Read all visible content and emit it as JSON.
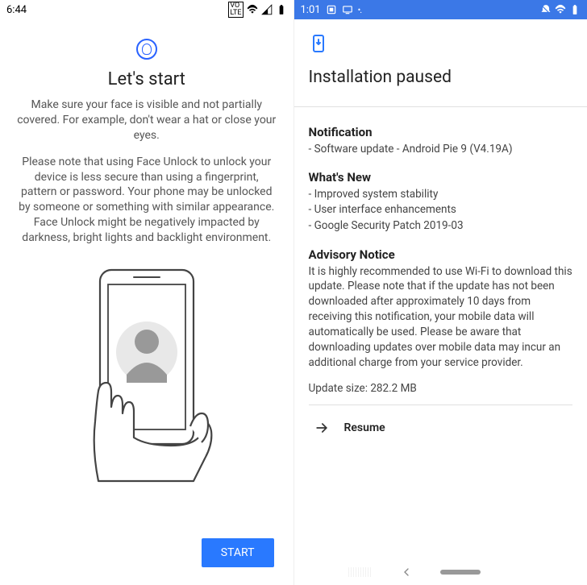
{
  "left": {
    "time": "6:44",
    "title": "Let's start",
    "paragraph1": "Make sure your face is visible and not partially covered. For example, don't wear a hat or close your eyes.",
    "paragraph2": "Please note that using Face Unlock to unlock your device is less secure than using a fingerprint, pattern or password. Your phone may be unlocked by someone or something with similar appearance. Face Unlock might be negatively impacted by darkness, bright lights and backlight environment.",
    "start_button": "START"
  },
  "right": {
    "time": "1:01",
    "title": "Installation paused",
    "notification_heading": "Notification",
    "notification_text": "- Software update - Android Pie 9 (V4.19A)",
    "whats_new_heading": "What's New",
    "whats_new_items": [
      "- Improved system stability",
      "- User interface enhancements",
      "- Google Security Patch 2019-03"
    ],
    "advisory_heading": "Advisory Notice",
    "advisory_text": "It is highly recommended to use Wi-Fi to download this update. Please note that if the update has not been downloaded after approximately 10 days from receiving this notification, your mobile data will automatically be used. Please be aware that downloading updates over mobile data may incur an additional charge from your service provider.",
    "update_size": "Update size: 282.2 MB",
    "resume_label": "Resume"
  }
}
